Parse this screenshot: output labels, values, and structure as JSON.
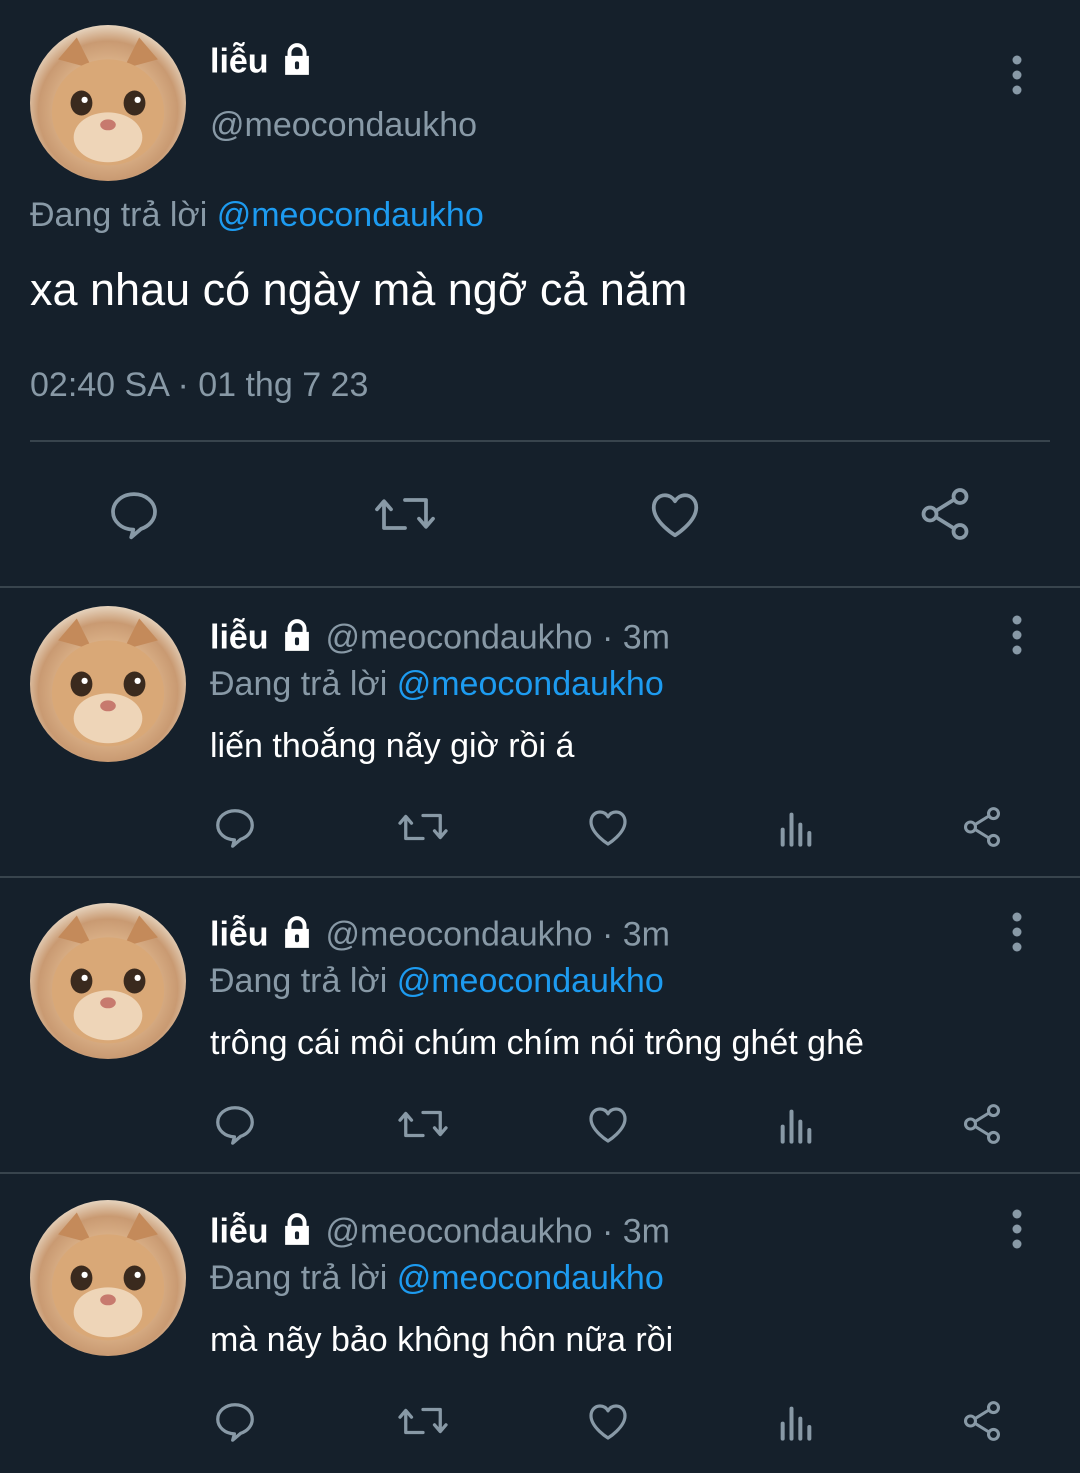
{
  "main_tweet": {
    "display_name": "liễu",
    "handle": "@meocondaukho",
    "reply_prefix": "Đang trả lời",
    "reply_to": "@meocondaukho",
    "text": "xa nhau có ngày mà ngỡ cả năm",
    "timestamp": "02:40 SA · 01 thg 7 23"
  },
  "replies": [
    {
      "display_name": "liễu",
      "handle": "@meocondaukho",
      "time": "· 3m",
      "reply_prefix": "Đang trả lời",
      "reply_to": "@meocondaukho",
      "text": "liến thoắng nãy giờ rồi á"
    },
    {
      "display_name": "liễu",
      "handle": "@meocondaukho",
      "time": "· 3m",
      "reply_prefix": "Đang trả lời",
      "reply_to": "@meocondaukho",
      "text": "trông cái môi chúm chím nói trông ghét ghê"
    },
    {
      "display_name": "liễu",
      "handle": "@meocondaukho",
      "time": "· 3m",
      "reply_prefix": "Đang trả lời",
      "reply_to": "@meocondaukho",
      "text": "mà nãy bảo không hôn nữa rồi"
    }
  ],
  "icons": {
    "reply": "reply-icon",
    "retweet": "retweet-icon",
    "like": "like-icon",
    "views": "views-icon",
    "share": "share-icon",
    "more": "more-icon",
    "lock": "lock-icon"
  },
  "colors": {
    "background": "#15202b",
    "accent": "#1d9bf0",
    "muted": "#8899a6",
    "divider": "#38444d"
  }
}
